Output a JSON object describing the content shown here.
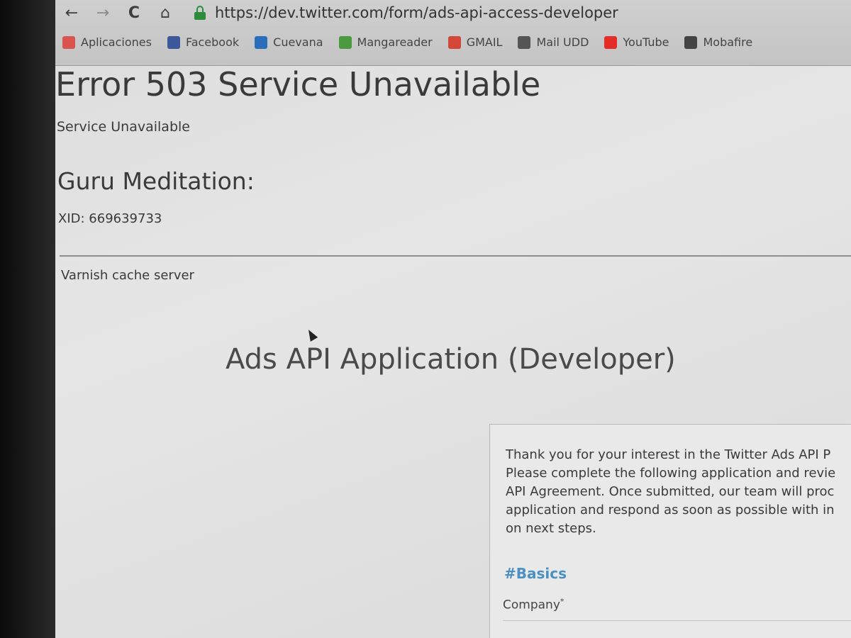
{
  "browser": {
    "nav": {
      "back": "←",
      "forward": "→",
      "reload": "C",
      "home": "⌂"
    },
    "url": "https://dev.twitter.com/form/ads-api-access-developer",
    "bookmarks": [
      {
        "label": "Aplicaciones",
        "icon": "apps-grid-icon",
        "color": "#d9534f"
      },
      {
        "label": "Facebook",
        "icon": "facebook-icon",
        "color": "#3b5998"
      },
      {
        "label": "Cuevana",
        "icon": "cuevana-icon",
        "color": "#2a6ebb"
      },
      {
        "label": "Mangareader",
        "icon": "mangareader-icon",
        "color": "#4c9a3f"
      },
      {
        "label": "GMAIL",
        "icon": "gmail-icon",
        "color": "#d44638"
      },
      {
        "label": "Mail UDD",
        "icon": "udd-icon",
        "color": "#555555"
      },
      {
        "label": "YouTube",
        "icon": "youtube-icon",
        "color": "#e52d27"
      },
      {
        "label": "Mobafire",
        "icon": "mobafire-icon",
        "color": "#444444"
      }
    ]
  },
  "error": {
    "title": "Error 503 Service Unavailable",
    "message": "Service Unavailable",
    "guru_heading": "Guru Meditation:",
    "xid": "XID: 669639733",
    "footer": "Varnish cache server"
  },
  "page": {
    "title": "Ads API Application (Developer)",
    "intro_lines": [
      "Thank you for your interest in the Twitter Ads API P",
      "Please complete the following application and revie",
      "API Agreement. Once submitted, our team will proc",
      "application and respond as soon as possible with in",
      "on next steps."
    ],
    "section": "#Basics",
    "field_company": "Company",
    "required_mark": "*"
  },
  "colors": {
    "accent_link": "#4a90c2",
    "secure_lock": "#2e8b3a"
  }
}
